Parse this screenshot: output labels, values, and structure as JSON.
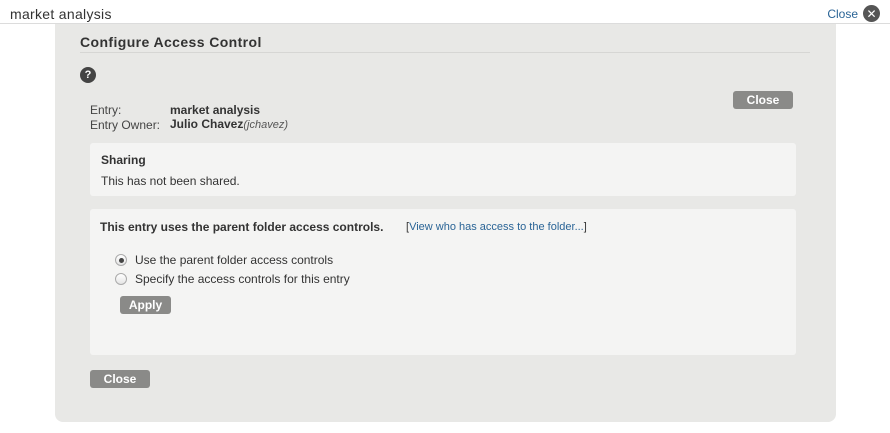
{
  "header": {
    "title": "market analysis",
    "close_label": "Close"
  },
  "dialog": {
    "title": "Configure Access Control",
    "entry_label": "Entry:",
    "entry_value": "market analysis",
    "owner_label": "Entry Owner:",
    "owner_name": "Julio Chavez",
    "owner_id": "(jchavez)",
    "close_top_label": "Close",
    "close_bottom_label": "Close"
  },
  "sharing": {
    "title": "Sharing",
    "text": "This has not been shared."
  },
  "access": {
    "title": "This entry uses the parent folder access controls.",
    "link_prefix": "[",
    "link_text": "View who has access to the folder...",
    "link_suffix": "]",
    "options": [
      {
        "label": "Use the parent folder access controls",
        "checked": true
      },
      {
        "label": "Specify the access controls for this entry",
        "checked": false
      }
    ],
    "apply_label": "Apply"
  },
  "colors": {
    "link": "#2a6496",
    "button": "#8a8a88",
    "panel": "#e8e8e6"
  }
}
